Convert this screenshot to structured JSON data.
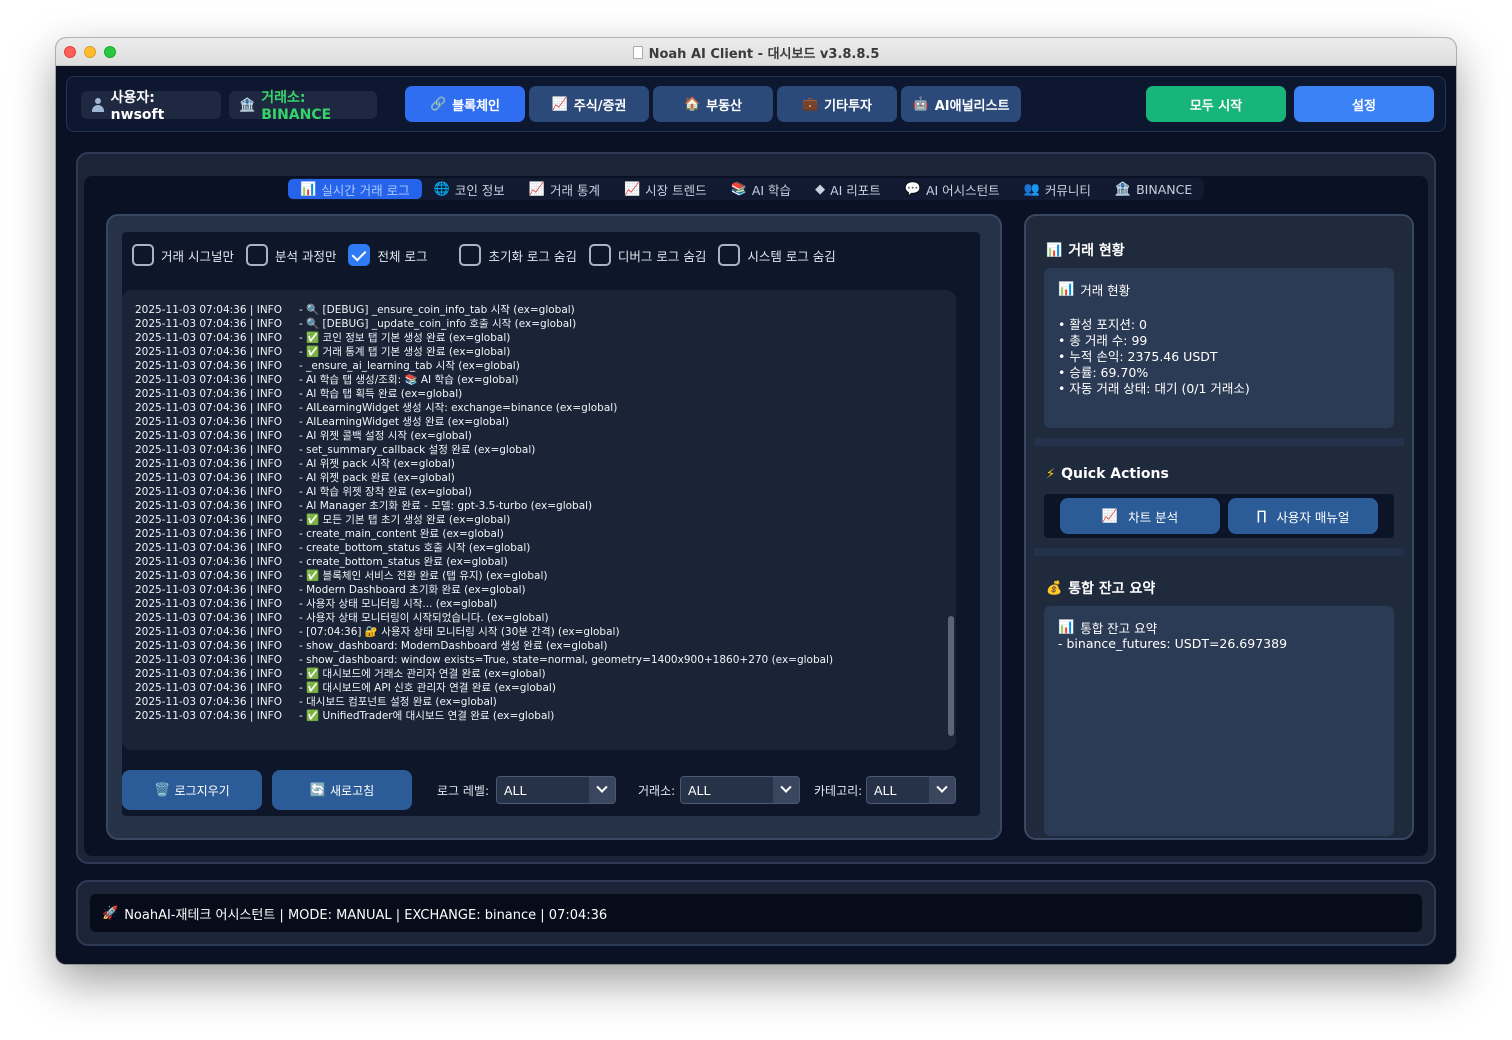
{
  "window": {
    "title": "Noah AI Client - 대시보드 v3.8.8.5"
  },
  "header": {
    "user_label": "사용자: nwsoft",
    "exchange_label": "거래소: BINANCE",
    "nav": [
      {
        "label": "블록체인",
        "icon": "link-icon",
        "active": true
      },
      {
        "label": "주식/증권",
        "icon": "chart-icon",
        "active": false
      },
      {
        "label": "부동산",
        "icon": "house-icon",
        "active": false
      },
      {
        "label": "기타투자",
        "icon": "briefcase-icon",
        "active": false
      },
      {
        "label": "AI애널리스트",
        "icon": "robot-icon",
        "active": false
      }
    ],
    "start_all": "모두 시작",
    "settings": "설정"
  },
  "tabs": [
    {
      "label": "실시간 거래 로그",
      "icon": "bar-chart-icon",
      "active": true
    },
    {
      "label": "코인 정보",
      "icon": "globe-icon"
    },
    {
      "label": "거래 통계",
      "icon": "line-chart-icon"
    },
    {
      "label": "시장 트렌드",
      "icon": "trend-icon"
    },
    {
      "label": "AI 학습",
      "icon": "books-icon"
    },
    {
      "label": "AI 리포트",
      "icon": "diamond-icon"
    },
    {
      "label": "AI 어시스턴트",
      "icon": "speech-icon"
    },
    {
      "label": "커뮤니티",
      "icon": "people-icon"
    },
    {
      "label": "BINANCE",
      "icon": "bank-icon"
    }
  ],
  "filters": [
    {
      "label": "거래 시그널만",
      "checked": false
    },
    {
      "label": "분석 과정만",
      "checked": false
    },
    {
      "label": "전체 로그",
      "checked": true
    },
    {
      "label": "초기화 로그 숨김",
      "checked": false
    },
    {
      "label": "디버그 로그 숨김",
      "checked": false
    },
    {
      "label": "시스템 로그 숨김",
      "checked": false
    }
  ],
  "log": {
    "lines": [
      {
        "ts": "2025-11-03 07:04:36 | INFO",
        "msg": "- 🔍 [DEBUG] _ensure_coin_info_tab 시작 (ex=global)"
      },
      {
        "ts": "2025-11-03 07:04:36 | INFO",
        "msg": "- 🔍 [DEBUG] _update_coin_info 호출 시작 (ex=global)"
      },
      {
        "ts": "2025-11-03 07:04:36 | INFO",
        "msg": "- ✅ 코인 정보 탭 기본 생성 완료 (ex=global)"
      },
      {
        "ts": "2025-11-03 07:04:36 | INFO",
        "msg": "- ✅ 거래 통계 탭 기본 생성 완료 (ex=global)"
      },
      {
        "ts": "2025-11-03 07:04:36 | INFO",
        "msg": "- _ensure_ai_learning_tab 시작 (ex=global)"
      },
      {
        "ts": "2025-11-03 07:04:36 | INFO",
        "msg": "- AI 학습 탭 생성/조회: 📚 AI 학습 (ex=global)"
      },
      {
        "ts": "2025-11-03 07:04:36 | INFO",
        "msg": "- AI 학습 탭 획득 완료 (ex=global)"
      },
      {
        "ts": "2025-11-03 07:04:36 | INFO",
        "msg": "- AILearningWidget 생성 시작: exchange=binance (ex=global)"
      },
      {
        "ts": "2025-11-03 07:04:36 | INFO",
        "msg": "- AILearningWidget 생성 완료 (ex=global)"
      },
      {
        "ts": "2025-11-03 07:04:36 | INFO",
        "msg": "- AI 위젯 콜백 설정 시작 (ex=global)"
      },
      {
        "ts": "2025-11-03 07:04:36 | INFO",
        "msg": "- set_summary_callback 설정 완료 (ex=global)"
      },
      {
        "ts": "2025-11-03 07:04:36 | INFO",
        "msg": "- AI 위젯 pack 시작 (ex=global)"
      },
      {
        "ts": "2025-11-03 07:04:36 | INFO",
        "msg": "- AI 위젯 pack 완료 (ex=global)"
      },
      {
        "ts": "2025-11-03 07:04:36 | INFO",
        "msg": "- AI 학습 위젯 장착 완료 (ex=global)"
      },
      {
        "ts": "2025-11-03 07:04:36 | INFO",
        "msg": "- AI Manager 초기화 완료 - 모델: gpt-3.5-turbo (ex=global)"
      },
      {
        "ts": "2025-11-03 07:04:36 | INFO",
        "msg": "- ✅ 모든 기본 탭 초기 생성 완료 (ex=global)"
      },
      {
        "ts": "2025-11-03 07:04:36 | INFO",
        "msg": "- create_main_content 완료 (ex=global)"
      },
      {
        "ts": "2025-11-03 07:04:36 | INFO",
        "msg": "- create_bottom_status 호출 시작 (ex=global)"
      },
      {
        "ts": "2025-11-03 07:04:36 | INFO",
        "msg": "- create_bottom_status 완료 (ex=global)"
      },
      {
        "ts": "2025-11-03 07:04:36 | INFO",
        "msg": "- ✅ 블록체인 서비스 전환 완료 (탭 유지) (ex=global)"
      },
      {
        "ts": "2025-11-03 07:04:36 | INFO",
        "msg": "- Modern Dashboard 초기화 완료 (ex=global)"
      },
      {
        "ts": "2025-11-03 07:04:36 | INFO",
        "msg": "- 사용자 상태 모니터링 시작... (ex=global)"
      },
      {
        "ts": "2025-11-03 07:04:36 | INFO",
        "msg": "- 사용자 상태 모니터링이 시작되었습니다. (ex=global)"
      },
      {
        "ts": "2025-11-03 07:04:36 | INFO",
        "msg": "- [07:04:36] 🔐 사용자 상태 모니터링 시작 (30분 간격) (ex=global)"
      },
      {
        "ts": "2025-11-03 07:04:36 | INFO",
        "msg": "- show_dashboard: ModernDashboard 생성 완료 (ex=global)"
      },
      {
        "ts": "2025-11-03 07:04:36 | INFO",
        "msg": "- show_dashboard: window exists=True, state=normal, geometry=1400x900+1860+270 (ex=global)"
      },
      {
        "ts": "2025-11-03 07:04:36 | INFO",
        "msg": "- ✅ 대시보드에 거래소 관리자 연결 완료 (ex=global)"
      },
      {
        "ts": "2025-11-03 07:04:36 | INFO",
        "msg": "- ✅ 대시보드에 API 신호 관리자 연결 완료 (ex=global)"
      },
      {
        "ts": "2025-11-03 07:04:36 | INFO",
        "msg": "- 대시보드 컴포넌트 설정 완료 (ex=global)"
      },
      {
        "ts": "2025-11-03 07:04:36 | INFO",
        "msg": "- ✅ UnifiedTrader에 대시보드 연결 완료 (ex=global)"
      }
    ]
  },
  "controls": {
    "clear_log": "로그지우기",
    "refresh": "새로고침",
    "log_level_label": "로그 레벨:",
    "log_level_value": "ALL",
    "exchange_label": "거래소:",
    "exchange_value": "ALL",
    "category_label": "카테고리:",
    "category_value": "ALL"
  },
  "trade_status": {
    "section_title": "거래 현황",
    "card_title": "거래 현황",
    "stats": [
      "• 활성 포지션: 0",
      "• 총 거래 수: 99",
      "• 누적 손익: 2375.46 USDT",
      "• 승률: 69.70%",
      "• 자동 거래 상태: 대기 (0/1 거래소)"
    ]
  },
  "quick_actions": {
    "title": "Quick Actions",
    "chart_analysis": "차트 분석",
    "user_manual": "사용자 매뉴얼"
  },
  "balance": {
    "section_title": "통합 잔고 요약",
    "card_title": "통합 잔고 요약",
    "line": "- binance_futures: USDT=26.697389"
  },
  "status_bar": {
    "text": "NoahAI-재테크 어시스턴트 | MODE: MANUAL | EXCHANGE: binance | 07:04:36"
  },
  "colors": {
    "accent_blue": "#2f6ef0",
    "start_green": "#17b57a",
    "exchange_green": "#35d46a"
  }
}
